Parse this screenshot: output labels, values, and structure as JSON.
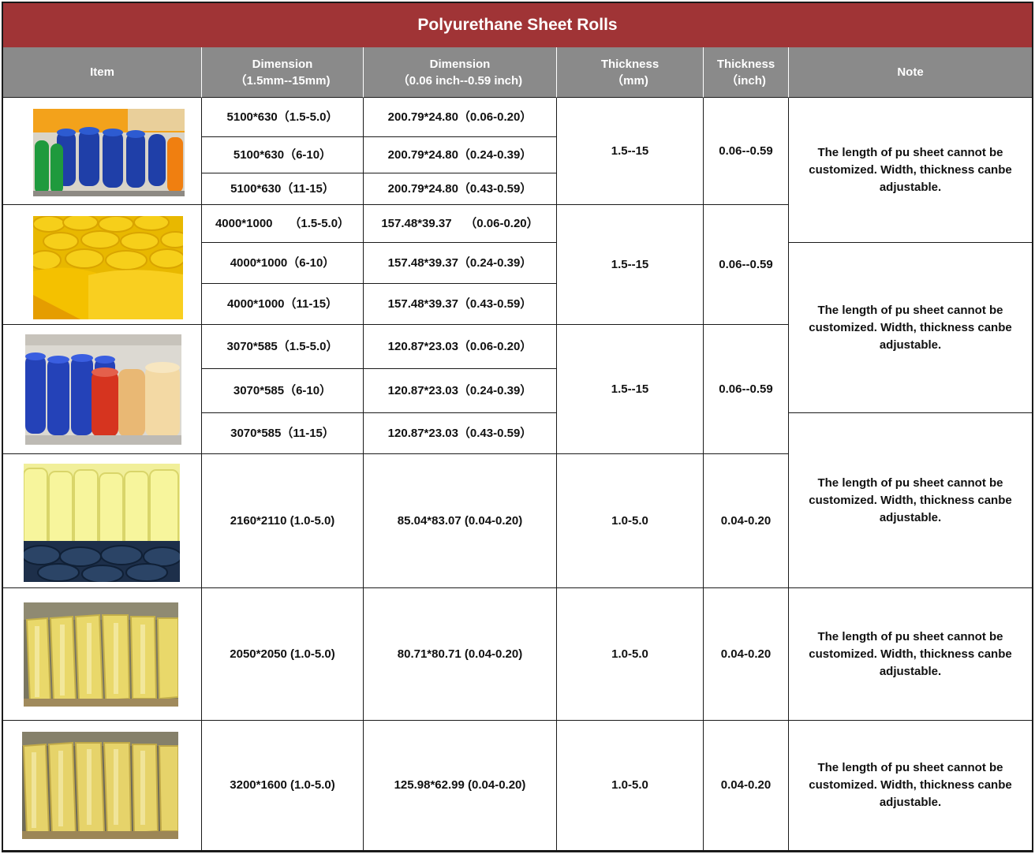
{
  "title": "Polyurethane Sheet Rolls",
  "headers": {
    "item": "Item",
    "dim_mm": "Dimension",
    "dim_mm_sub": "（1.5mm--15mm)",
    "dim_inch": "Dimension",
    "dim_inch_sub": "（0.06 inch--0.59 inch)",
    "thick_mm": "Thickness",
    "thick_mm_sub": "（mm)",
    "thick_inch": "Thickness",
    "thick_inch_sub": "（inch)",
    "note": "Note"
  },
  "groups": [
    {
      "image": "orange-green-blue-rolls-photo",
      "thickness_mm": "1.5--15",
      "thickness_inch": "0.06--0.59",
      "rows": [
        {
          "dim_mm": "5100*630（1.5-5.0）",
          "dim_inch": "200.79*24.80（0.06-0.20）"
        },
        {
          "dim_mm": "5100*630（6-10）",
          "dim_inch": "200.79*24.80（0.24-0.39）"
        },
        {
          "dim_mm": "5100*630（11-15）",
          "dim_inch": "200.79*24.80（0.43-0.59）"
        }
      ]
    },
    {
      "image": "yellow-sheet-rolls-photo",
      "thickness_mm": "1.5--15",
      "thickness_inch": "0.06--0.59",
      "rows": [
        {
          "dim_mm": "4000*1000     （1.5-5.0）",
          "dim_inch": "157.48*39.37    （0.06-0.20）"
        },
        {
          "dim_mm": "4000*1000（6-10）",
          "dim_inch": "157.48*39.37（0.24-0.39）"
        },
        {
          "dim_mm": "4000*1000（11-15）",
          "dim_inch": "157.48*39.37（0.43-0.59）"
        }
      ]
    },
    {
      "image": "blue-red-amber-rolls-photo",
      "thickness_mm": "1.5--15",
      "thickness_inch": "0.06--0.59",
      "rows": [
        {
          "dim_mm": "3070*585（1.5-5.0）",
          "dim_inch": "120.87*23.03（0.06-0.20）"
        },
        {
          "dim_mm": "3070*585（6-10）",
          "dim_inch": "120.87*23.03（0.24-0.39）"
        },
        {
          "dim_mm": "3070*585（11-15）",
          "dim_inch": "120.87*23.03（0.43-0.59）"
        }
      ]
    }
  ],
  "singles": [
    {
      "image": "clear-yellow-rolls-blue-base-photo",
      "dim_mm": "2160*2110 (1.0-5.0)",
      "dim_inch": "85.04*83.07 (0.04-0.20)",
      "thickness_mm": "1.0-5.0",
      "thickness_inch": "0.04-0.20"
    },
    {
      "image": "translucent-yellow-rolls-photo",
      "dim_mm": "2050*2050 (1.0-5.0)",
      "dim_inch": "80.71*80.71 (0.04-0.20)",
      "thickness_mm": "1.0-5.0",
      "thickness_inch": "0.04-0.20"
    },
    {
      "image": "translucent-yellow-rolls-photo-2",
      "dim_mm": "3200*1600 (1.0-5.0)",
      "dim_inch": "125.98*62.99 (0.04-0.20)",
      "thickness_mm": "1.0-5.0",
      "thickness_inch": "0.04-0.20"
    }
  ],
  "notes": [
    "The length of pu sheet cannot be customized. Width, thickness canbe adjustable.",
    "The length of pu sheet cannot be customized. Width, thickness canbe adjustable.",
    "The length of pu sheet cannot be customized. Width, thickness canbe adjustable.",
    "The length of pu sheet cannot be customized. Width, thickness canbe adjustable.",
    "The length of pu sheet cannot be customized. Width, thickness canbe adjustable."
  ],
  "colors": {
    "title_bg": "#a03436",
    "header_bg": "#8a8a8a",
    "border": "#1a1a1a"
  }
}
